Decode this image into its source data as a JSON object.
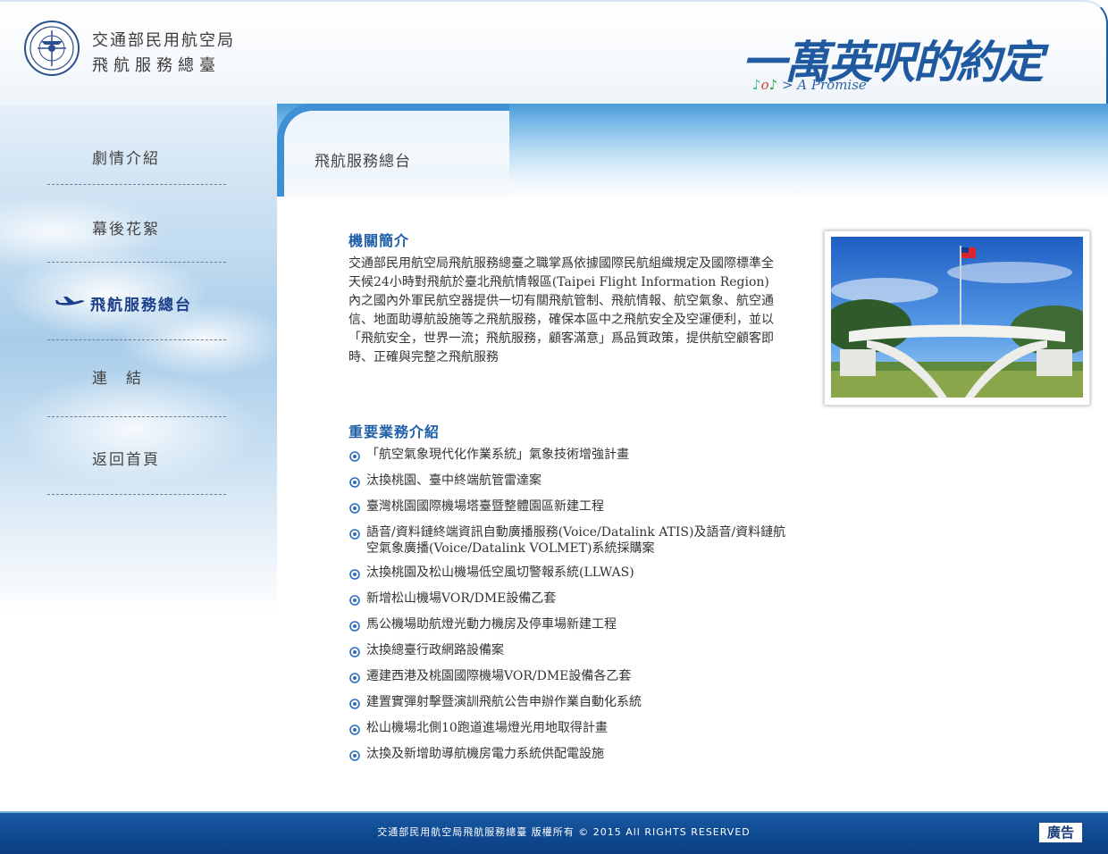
{
  "header": {
    "org_line1": "交通部民用航空局",
    "org_line2": "飛航服務總臺",
    "banner_title": "一萬英呎的約定",
    "banner_subtitle": "> A Promise"
  },
  "nav": {
    "items": [
      {
        "label": "劇情介紹",
        "active": false
      },
      {
        "label": "幕後花絮",
        "active": false
      },
      {
        "label": "飛航服務總台",
        "active": true
      },
      {
        "label": "連　結",
        "active": false
      },
      {
        "label": "返回首頁",
        "active": false
      }
    ]
  },
  "section": {
    "title": "飛航服務總台"
  },
  "intro": {
    "heading": "機關簡介",
    "text": "交通部民用航空局飛航服務總臺之職掌爲依據國際民航組織規定及國際標準全天候24小時對飛航於臺北飛航情報區(Taipei Flight Information Region)內之國內外軍民航空器提供一切有關飛航管制、飛航情報、航空氣象、航空通信、地面助導航設施等之飛航服務，確保本區中之飛航安全及空運便利，並以「飛航安全，世界一流；飛航服務，顧客滿意」爲品質政策，提供航空顧客即時、正確與完整之飛航服務"
  },
  "business": {
    "heading": "重要業務介紹",
    "items": [
      "「航空氣象現代化作業系統」氣象技術增強計畫",
      "汰換桃園、臺中終端航管雷達案",
      "臺灣桃園國際機場塔臺暨整體園區新建工程",
      "語音/資料鏈終端資訊自動廣播服務(Voice/Datalink ATIS)及語音/資料鏈航空氣象廣播(Voice/Datalink VOLMET)系統採購案",
      "汰換桃園及松山機場低空風切警報系統(LLWAS)",
      "新增松山機場VOR/DME設備乙套",
      "馬公機場助航燈光動力機房及停車場新建工程",
      "汰換總臺行政網路設備案",
      "遷建西港及桃園國際機場VOR/DME設備各乙套",
      "建置實彈射擊暨演訓飛航公告申辦作業自動化系統",
      "松山機場北側10跑道進場燈光用地取得計畫",
      "汰換及新增助導航機房電力系統供配電設施"
    ]
  },
  "footer": {
    "copyright": "交通部民用航空局飛航服務總臺 版權所有 © 2015 All RIGHTS RESERVED",
    "ad_label": "廣告"
  },
  "colors": {
    "accent": "#2060a8",
    "footer_bg": "#0f4a92",
    "nav_active": "#1c3f8a"
  }
}
